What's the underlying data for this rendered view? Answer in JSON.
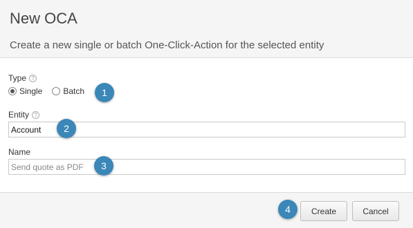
{
  "dialog": {
    "title": "New OCA",
    "subtitle": "Create a new single or batch One-Click-Action for the selected entity"
  },
  "form": {
    "type": {
      "label": "Type",
      "help_icon": "help-icon",
      "options": [
        {
          "label": "Single",
          "checked": true
        },
        {
          "label": "Batch",
          "checked": false
        }
      ]
    },
    "entity": {
      "label": "Entity",
      "help_icon": "help-icon",
      "value": "Account"
    },
    "name": {
      "label": "Name",
      "value": "",
      "placeholder": "Send quote as PDF"
    }
  },
  "badges": [
    "1",
    "2",
    "3",
    "4"
  ],
  "footer": {
    "create_label": "Create",
    "cancel_label": "Cancel"
  },
  "colors": {
    "badge": "#3a87b8",
    "header_bg": "#f5f5f5"
  }
}
